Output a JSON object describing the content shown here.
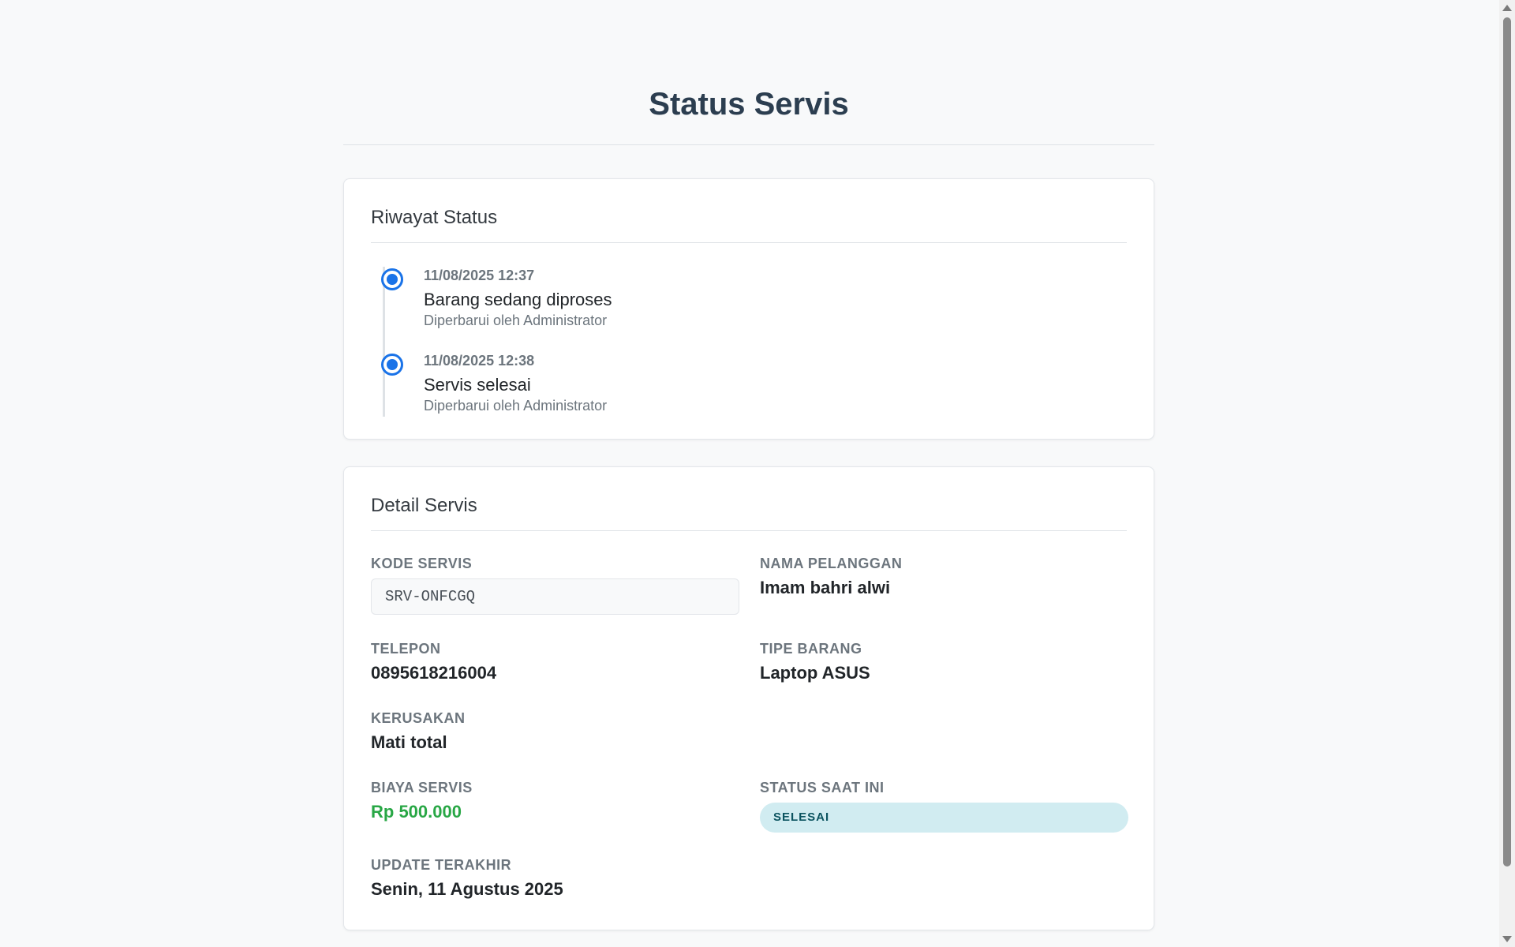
{
  "page": {
    "title": "Status Servis"
  },
  "history": {
    "title": "Riwayat Status",
    "items": [
      {
        "time": "11/08/2025 12:37",
        "status": "Barang sedang diproses",
        "updated_by": "Diperbarui oleh Administrator"
      },
      {
        "time": "11/08/2025 12:38",
        "status": "Servis selesai",
        "updated_by": "Diperbarui oleh Administrator"
      }
    ]
  },
  "detail": {
    "title": "Detail Servis",
    "kode_servis": {
      "label": "KODE SERVIS",
      "value": "SRV-ONFCGQ"
    },
    "nama_pelanggan": {
      "label": "NAMA PELANGGAN",
      "value": "Imam bahri alwi"
    },
    "telepon": {
      "label": "TELEPON",
      "value": "0895618216004"
    },
    "tipe_barang": {
      "label": "TIPE BARANG",
      "value": "Laptop ASUS"
    },
    "kerusakan": {
      "label": "KERUSAKAN",
      "value": "Mati total"
    },
    "biaya_servis": {
      "label": "BIAYA SERVIS",
      "value": "Rp 500.000"
    },
    "status_saat_ini": {
      "label": "STATUS SAAT INI",
      "value": "SELESAI"
    },
    "update_terakhir": {
      "label": "UPDATE TERAKHIR",
      "value": "Senin, 11 Agustus 2025"
    }
  },
  "colors": {
    "accent": "#1a73e8",
    "price": "#28a745",
    "badge_bg": "#d1ecf1",
    "badge_text": "#0c5460"
  },
  "icons": {
    "timeline_marker": "timeline-dot-icon",
    "scroll_up": "scroll-up-arrow-icon",
    "scroll_down": "scroll-down-arrow-icon"
  }
}
